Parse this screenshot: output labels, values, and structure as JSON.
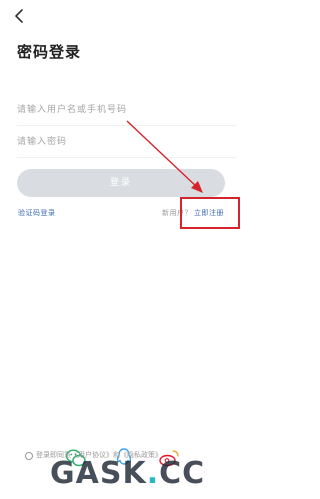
{
  "header": {
    "back_icon": "chevron-left-icon",
    "title": "密码登录"
  },
  "form": {
    "username_placeholder": "请输入用户名或手机号码",
    "password_placeholder": "请输入密码",
    "login_label": "登录"
  },
  "links": {
    "sms_login": "验证码登录",
    "new_user_prompt": "新用户？",
    "register": "立即注册"
  },
  "footer": {
    "social_icons": [
      "wechat-icon",
      "qq-icon",
      "weibo-icon"
    ],
    "agreement_text": "登录即同意《用户协议》和《隐私政策》"
  },
  "watermark": {
    "text_before": "GASK",
    "dot": ".",
    "text_after": "CC"
  },
  "colors": {
    "link": "#3c6ab3",
    "button_disabled": "#d9dde1",
    "annotation": "#d6242c",
    "wechat": "#2aae67",
    "qq": "#3ba3e8",
    "weibo": "#e6162d"
  }
}
